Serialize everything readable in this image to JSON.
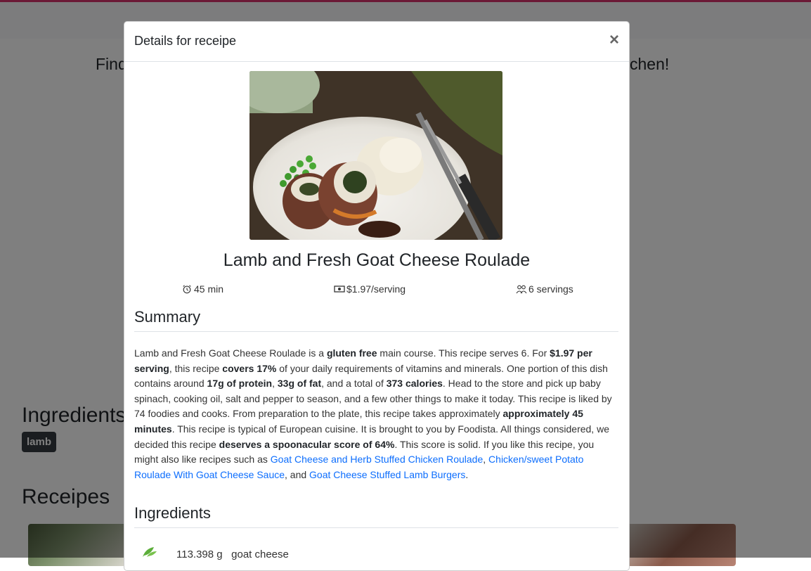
{
  "background": {
    "tagline_left": "Find",
    "tagline_right": "chen!",
    "ingredients_heading": "Ingredients",
    "ingredient_badge": "lamb",
    "receipes_heading": "Receipes"
  },
  "modal": {
    "title": "Details for receipe",
    "close_symbol": "×",
    "recipe": {
      "name": "Lamb and Fresh Goat Cheese Roulade",
      "time": "45 min",
      "price": "$1.97/serving",
      "servings": "6 servings"
    },
    "summary_heading": "Summary",
    "summary": {
      "t1": "Lamb and Fresh Goat Cheese Roulade is a ",
      "b1": "gluten free",
      "t2": " main course. This recipe serves 6. For ",
      "b2": "$1.97 per serving",
      "t3": ", this recipe ",
      "b3": "covers 17%",
      "t4": " of your daily requirements of vitamins and minerals. One portion of this dish contains around ",
      "b4": "17g of protein",
      "t5": ", ",
      "b5": "33g of fat",
      "t6": ", and a total of ",
      "b6": "373 calories",
      "t7": ". Head to the store and pick up baby spinach, cooking oil, salt and pepper to season, and a few other things to make it today. This recipe is liked by 74 foodies and cooks. From preparation to the plate, this recipe takes approximately ",
      "b7": "approximately 45 minutes",
      "t8": ". This recipe is typical of European cuisine. It is brought to you by Foodista. All things considered, we decided this recipe ",
      "b8": "deserves a spoonacular score of 64%",
      "t9": ". This score is solid. If you like this recipe, you might also like recipes such as ",
      "link1": "Goat Cheese and Herb Stuffed Chicken Roulade",
      "t10": ", ",
      "link2": "Chicken/sweet Potato Roulade With Goat Cheese Sauce",
      "t11": ", and ",
      "link3": "Goat Cheese Stuffed Lamb Burgers",
      "t12": "."
    },
    "ingredients_heading": "Ingredients",
    "ingredients": [
      {
        "amount": "113.398 g",
        "name": "goat cheese"
      }
    ]
  },
  "colors": {
    "accent_bar": "#d6336c",
    "link": "#0d6efd",
    "badge_bg": "#343a40"
  },
  "icons": [
    "alarm-icon",
    "cash-icon",
    "people-icon",
    "close-icon",
    "herb-icon"
  ]
}
